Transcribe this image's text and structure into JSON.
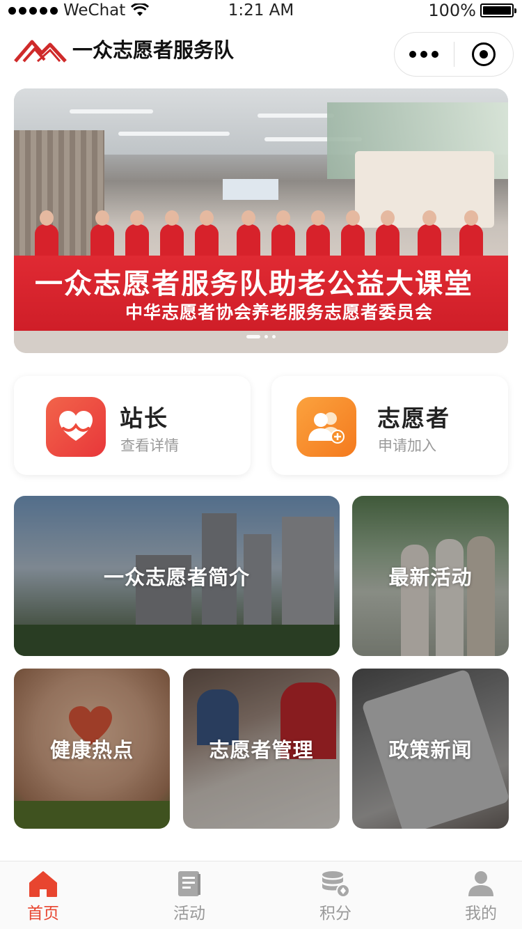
{
  "status_bar": {
    "carrier": "WeChat",
    "time": "1:21 AM",
    "battery": "100%"
  },
  "nav": {
    "title": "一众志愿者服务队"
  },
  "banner": {
    "line1": "一众志愿者服务队助老公益大课堂",
    "line2": "中华志愿者协会养老服务志愿者委员会",
    "slides": 3,
    "active_slide": 1
  },
  "quick_cards": [
    {
      "title": "站长",
      "subtitle": "查看详情",
      "icon": "heart-icon",
      "color": "#ee4a3b"
    },
    {
      "title": "志愿者",
      "subtitle": "申请加入",
      "icon": "users-add-icon",
      "color": "#f7902b"
    }
  ],
  "tiles": {
    "intro": "一众志愿者简介",
    "activities": "最新活动",
    "health": "健康热点",
    "management": "志愿者管理",
    "news": "政策新闻"
  },
  "tabbar": {
    "items": [
      {
        "label": "首页",
        "icon": "home-icon",
        "active": true
      },
      {
        "label": "活动",
        "icon": "document-icon",
        "active": false
      },
      {
        "label": "积分",
        "icon": "coins-icon",
        "active": false
      },
      {
        "label": "我的",
        "icon": "user-icon",
        "active": false
      }
    ],
    "active_color": "#e8452f",
    "inactive_color": "#999999"
  }
}
